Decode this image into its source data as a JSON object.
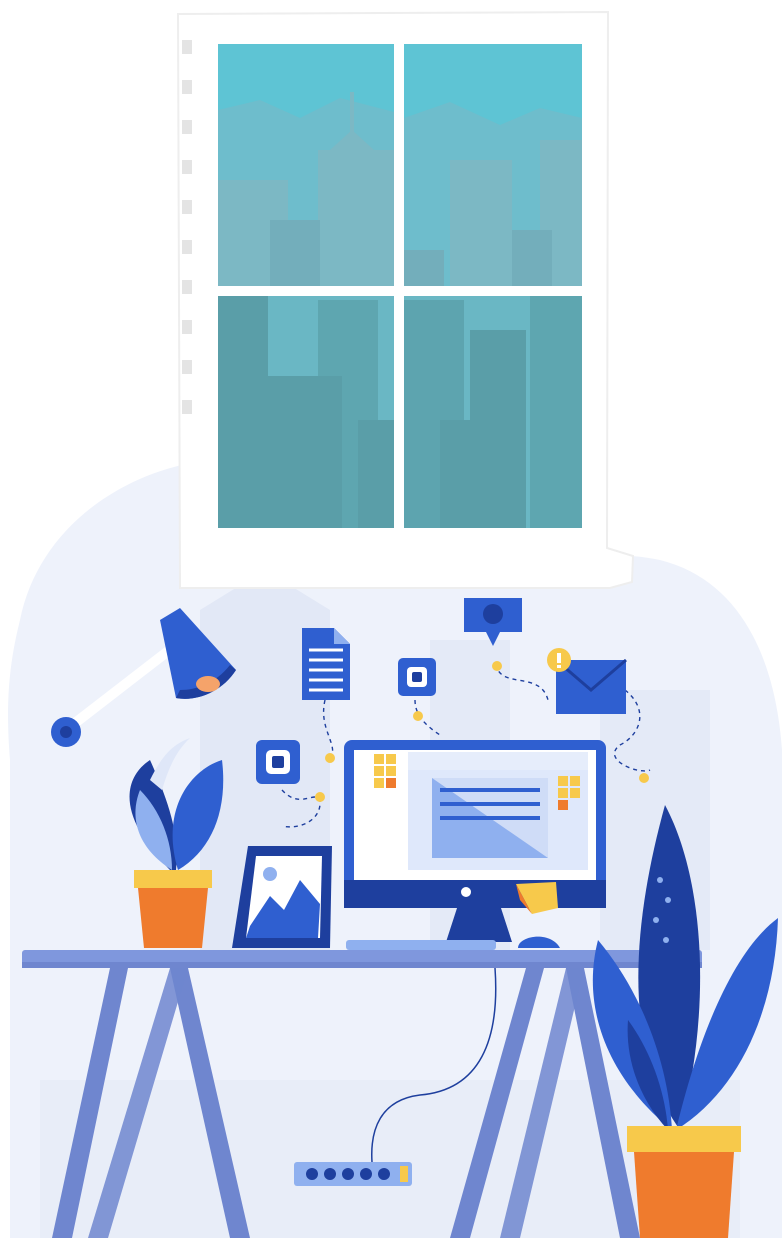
{
  "scene": {
    "subject": "workspace-illustration",
    "colors": {
      "background": "#ffffff",
      "backdrop_blob": "#eef2fb",
      "backdrop_shape": "#e2e8f6",
      "sky": "#5ec4d4",
      "skyline_light": "#7cb8c4",
      "skyline_dark": "#5a9ea8",
      "window_frame": "#ffffff",
      "desk_top": "#7f97dd",
      "desk_legs": "#6f86cf",
      "primary_blue": "#2f5fd0",
      "dark_blue": "#1e3f9e",
      "light_blue": "#8fb0ef",
      "accent_orange": "#ef7b2d",
      "accent_yellow": "#f7c94b",
      "screen": "#ffffff"
    }
  },
  "icons": [
    "desk-lamp-icon",
    "document-icon",
    "chat-bubble-icon",
    "location-pin-icon",
    "envelope-icon",
    "notification-badge-icon",
    "picture-frame-icon",
    "computer-monitor-icon",
    "computer-mouse-icon",
    "power-strip-icon",
    "potted-plant-icon"
  ]
}
